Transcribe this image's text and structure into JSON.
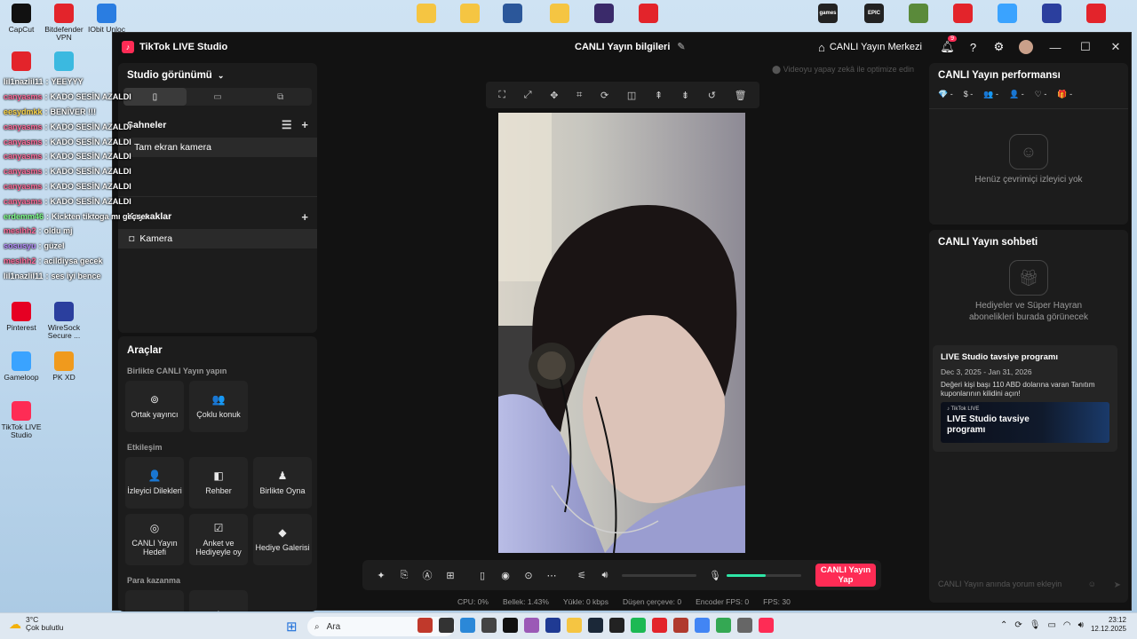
{
  "desktop": {
    "icons": [
      {
        "label": "CapCut",
        "color": "#111"
      },
      {
        "label": "Bitdefender VPN",
        "color": "#e3242b"
      },
      {
        "label": "IObit Unloc",
        "color": "#2a7de1"
      },
      {
        "label": "",
        "color": "#e3242b"
      },
      {
        "label": "",
        "color": "#3bb9e0"
      },
      {
        "label": "Pinterest",
        "color": "#e60023"
      },
      {
        "label": "WireSock Secure ...",
        "color": "#2b3f9e"
      },
      {
        "label": "Gameloop",
        "color": "#3aa3ff"
      },
      {
        "label": "PK XD",
        "color": "#f09a1d"
      },
      {
        "label": "TikTok LIVE Studio",
        "color": "#fe2c55"
      }
    ],
    "top_icons": [
      {
        "label": "",
        "color": "#f5c542"
      },
      {
        "label": "",
        "color": "#f5c542"
      },
      {
        "label": "",
        "color": "#2b579a"
      },
      {
        "label": "",
        "color": "#f5c542"
      },
      {
        "label": "",
        "color": "#3a2a6a"
      },
      {
        "label": "",
        "color": "#e3242b"
      },
      {
        "label": "games",
        "color": "#222"
      },
      {
        "label": "EPIC",
        "color": "#222"
      },
      {
        "label": "",
        "color": "#5a8a3a"
      },
      {
        "label": "",
        "color": "#e3242b"
      },
      {
        "label": "",
        "color": "#3aa3ff"
      },
      {
        "label": "",
        "color": "#2b3f9e"
      },
      {
        "label": "",
        "color": "#e3242b"
      }
    ]
  },
  "chat_overlay": [
    {
      "user": "lil1nazlil11",
      "user_color": "#ffffff",
      "msg": "YEEYYY"
    },
    {
      "user": "canyasms",
      "user_color": "#ff6b9a",
      "msg": "KADO SESİN AZALDI"
    },
    {
      "user": "eesydmkk",
      "user_color": "#ffd84a",
      "msg": "BENİVER !!!"
    },
    {
      "user": "canyasms",
      "user_color": "#ff6b9a",
      "msg": "KADO SESİN AZALDI"
    },
    {
      "user": "canyasms",
      "user_color": "#ff6b9a",
      "msg": "KADO SESİN AZALDI"
    },
    {
      "user": "canyasms",
      "user_color": "#ff6b9a",
      "msg": "KADO SESİN AZALDI"
    },
    {
      "user": "canyasms",
      "user_color": "#ff6b9a",
      "msg": "KADO SESİN AZALDI"
    },
    {
      "user": "canyasms",
      "user_color": "#ff6b9a",
      "msg": "KADO SESİN AZALDI"
    },
    {
      "user": "canyasms",
      "user_color": "#ff6b9a",
      "msg": "KADO SESİN AZALDI"
    },
    {
      "user": "erdemm46",
      "user_color": "#7fff8a",
      "msg": "Kickten tiktoga mı geçsek"
    },
    {
      "user": "mesihh2",
      "user_color": "#ff6b9a",
      "msg": "oldu mj"
    },
    {
      "user": "sosusyu",
      "user_color": "#b88cff",
      "msg": "güzel"
    },
    {
      "user": "mesihh2",
      "user_color": "#ff6b9a",
      "msg": "acildiysa gecek"
    },
    {
      "user": "lil1nazlil11",
      "user_color": "#ffffff",
      "msg": "ses iyi bence"
    }
  ],
  "window": {
    "app_title": "TikTok LIVE Studio",
    "center_title": "CANLI Yayın bilgileri",
    "edit_icon": "✎",
    "live_center": "CANLI Yayın Merkezi",
    "notification_count": "9"
  },
  "left": {
    "studio_view": "Studio görünümü",
    "scenes_label": "Sahneler",
    "scene_item": "Tam ekran kamera",
    "sources_label": "Kaynaklar",
    "source_item": "Kamera"
  },
  "tools": {
    "title": "Araçlar",
    "group1": "Birlikte CANLI Yayın yapın",
    "group1_items": [
      {
        "label": "Ortak yayıncı",
        "icon": "⊚"
      },
      {
        "label": "Çoklu konuk",
        "icon": "👥"
      }
    ],
    "group2": "Etkileşim",
    "group2_items": [
      {
        "label": "İzleyici Dilekleri",
        "icon": "👤"
      },
      {
        "label": "Rehber",
        "icon": "◧"
      },
      {
        "label": "Birlikte Oyna",
        "icon": "♟"
      },
      {
        "label": "CANLI Yayın Hedefi",
        "icon": "◎"
      },
      {
        "label": "Anket ve Hediyeyle oy",
        "icon": "☑"
      },
      {
        "label": "Hediye Galerisi",
        "icon": "◆"
      }
    ],
    "group3": "Para kazanma"
  },
  "preview": {
    "ai_hint": "Videoyu yapay zekâ ile optimize edin",
    "go_live": "CANLI Yayın Yap",
    "mic_level": 0.52,
    "volume_level": 0.0
  },
  "stats": {
    "cpu": "CPU: 0%",
    "memory": "Bellek: 1.43%",
    "upload": "Yükle: 0 kbps",
    "dropped": "Düşen çerçeve: 0",
    "encoder": "Encoder FPS: 0",
    "fps": "FPS: 30"
  },
  "right": {
    "perf_title": "CANLI Yayın performansı",
    "perf_stats": [
      {
        "icon": "💎",
        "value": "-"
      },
      {
        "icon": "$",
        "value": "-"
      },
      {
        "icon": "👥",
        "value": "-"
      },
      {
        "icon": "👤",
        "value": "-"
      },
      {
        "icon": "♡",
        "value": "-"
      },
      {
        "icon": "🎁",
        "value": "-"
      }
    ],
    "no_viewers": "Henüz çevrimiçi izleyici yok",
    "chat_title": "CANLI Yayın sohbeti",
    "chat_empty": "Hediyeler ve Süper Hayran abonelikleri burada görünecek",
    "promo_title": "LIVE Studio tavsiye programı",
    "promo_dates": "Dec 3, 2025 - Jan 31, 2026",
    "promo_desc": "Değeri kişi başı 110 ABD dolarına varan Tanıtım kuponlarının kilidini açın!",
    "promo_banner_small": "♪ TikTok LIVE",
    "promo_banner_big": "LIVE Studio tavsiye programı",
    "chat_placeholder": "CANLI Yayın anında yorum ekleyin"
  },
  "taskbar": {
    "temp": "3°C",
    "weather": "Çok bulutlu",
    "search": "Ara",
    "time": "23:12",
    "date": "12.12.2025",
    "apps": [
      {
        "color": "#c0392b"
      },
      {
        "color": "#333"
      },
      {
        "color": "#2b88d8"
      },
      {
        "color": "#444"
      },
      {
        "color": "#111"
      },
      {
        "color": "#9b59b6"
      },
      {
        "color": "#1f3a93"
      },
      {
        "color": "#f5c542"
      },
      {
        "color": "#1b2838"
      },
      {
        "color": "#222"
      },
      {
        "color": "#1db954"
      },
      {
        "color": "#e3242b"
      },
      {
        "color": "#b03a2e"
      },
      {
        "color": "#4285f4"
      },
      {
        "color": "#34a853"
      },
      {
        "color": "#666"
      },
      {
        "color": "#fe2c55"
      }
    ]
  }
}
